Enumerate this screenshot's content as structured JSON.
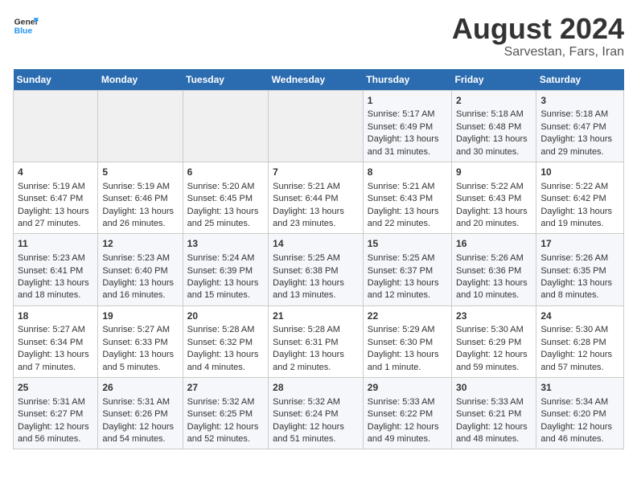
{
  "header": {
    "logo_general": "General",
    "logo_blue": "Blue",
    "title": "August 2024",
    "subtitle": "Sarvestan, Fars, Iran"
  },
  "calendar": {
    "days_of_week": [
      "Sunday",
      "Monday",
      "Tuesday",
      "Wednesday",
      "Thursday",
      "Friday",
      "Saturday"
    ],
    "weeks": [
      [
        {
          "day": "",
          "content": ""
        },
        {
          "day": "",
          "content": ""
        },
        {
          "day": "",
          "content": ""
        },
        {
          "day": "",
          "content": ""
        },
        {
          "day": "1",
          "content": "Sunrise: 5:17 AM\nSunset: 6:49 PM\nDaylight: 13 hours and 31 minutes."
        },
        {
          "day": "2",
          "content": "Sunrise: 5:18 AM\nSunset: 6:48 PM\nDaylight: 13 hours and 30 minutes."
        },
        {
          "day": "3",
          "content": "Sunrise: 5:18 AM\nSunset: 6:47 PM\nDaylight: 13 hours and 29 minutes."
        }
      ],
      [
        {
          "day": "4",
          "content": "Sunrise: 5:19 AM\nSunset: 6:47 PM\nDaylight: 13 hours and 27 minutes."
        },
        {
          "day": "5",
          "content": "Sunrise: 5:19 AM\nSunset: 6:46 PM\nDaylight: 13 hours and 26 minutes."
        },
        {
          "day": "6",
          "content": "Sunrise: 5:20 AM\nSunset: 6:45 PM\nDaylight: 13 hours and 25 minutes."
        },
        {
          "day": "7",
          "content": "Sunrise: 5:21 AM\nSunset: 6:44 PM\nDaylight: 13 hours and 23 minutes."
        },
        {
          "day": "8",
          "content": "Sunrise: 5:21 AM\nSunset: 6:43 PM\nDaylight: 13 hours and 22 minutes."
        },
        {
          "day": "9",
          "content": "Sunrise: 5:22 AM\nSunset: 6:43 PM\nDaylight: 13 hours and 20 minutes."
        },
        {
          "day": "10",
          "content": "Sunrise: 5:22 AM\nSunset: 6:42 PM\nDaylight: 13 hours and 19 minutes."
        }
      ],
      [
        {
          "day": "11",
          "content": "Sunrise: 5:23 AM\nSunset: 6:41 PM\nDaylight: 13 hours and 18 minutes."
        },
        {
          "day": "12",
          "content": "Sunrise: 5:23 AM\nSunset: 6:40 PM\nDaylight: 13 hours and 16 minutes."
        },
        {
          "day": "13",
          "content": "Sunrise: 5:24 AM\nSunset: 6:39 PM\nDaylight: 13 hours and 15 minutes."
        },
        {
          "day": "14",
          "content": "Sunrise: 5:25 AM\nSunset: 6:38 PM\nDaylight: 13 hours and 13 minutes."
        },
        {
          "day": "15",
          "content": "Sunrise: 5:25 AM\nSunset: 6:37 PM\nDaylight: 13 hours and 12 minutes."
        },
        {
          "day": "16",
          "content": "Sunrise: 5:26 AM\nSunset: 6:36 PM\nDaylight: 13 hours and 10 minutes."
        },
        {
          "day": "17",
          "content": "Sunrise: 5:26 AM\nSunset: 6:35 PM\nDaylight: 13 hours and 8 minutes."
        }
      ],
      [
        {
          "day": "18",
          "content": "Sunrise: 5:27 AM\nSunset: 6:34 PM\nDaylight: 13 hours and 7 minutes."
        },
        {
          "day": "19",
          "content": "Sunrise: 5:27 AM\nSunset: 6:33 PM\nDaylight: 13 hours and 5 minutes."
        },
        {
          "day": "20",
          "content": "Sunrise: 5:28 AM\nSunset: 6:32 PM\nDaylight: 13 hours and 4 minutes."
        },
        {
          "day": "21",
          "content": "Sunrise: 5:28 AM\nSunset: 6:31 PM\nDaylight: 13 hours and 2 minutes."
        },
        {
          "day": "22",
          "content": "Sunrise: 5:29 AM\nSunset: 6:30 PM\nDaylight: 13 hours and 1 minute."
        },
        {
          "day": "23",
          "content": "Sunrise: 5:30 AM\nSunset: 6:29 PM\nDaylight: 12 hours and 59 minutes."
        },
        {
          "day": "24",
          "content": "Sunrise: 5:30 AM\nSunset: 6:28 PM\nDaylight: 12 hours and 57 minutes."
        }
      ],
      [
        {
          "day": "25",
          "content": "Sunrise: 5:31 AM\nSunset: 6:27 PM\nDaylight: 12 hours and 56 minutes."
        },
        {
          "day": "26",
          "content": "Sunrise: 5:31 AM\nSunset: 6:26 PM\nDaylight: 12 hours and 54 minutes."
        },
        {
          "day": "27",
          "content": "Sunrise: 5:32 AM\nSunset: 6:25 PM\nDaylight: 12 hours and 52 minutes."
        },
        {
          "day": "28",
          "content": "Sunrise: 5:32 AM\nSunset: 6:24 PM\nDaylight: 12 hours and 51 minutes."
        },
        {
          "day": "29",
          "content": "Sunrise: 5:33 AM\nSunset: 6:22 PM\nDaylight: 12 hours and 49 minutes."
        },
        {
          "day": "30",
          "content": "Sunrise: 5:33 AM\nSunset: 6:21 PM\nDaylight: 12 hours and 48 minutes."
        },
        {
          "day": "31",
          "content": "Sunrise: 5:34 AM\nSunset: 6:20 PM\nDaylight: 12 hours and 46 minutes."
        }
      ]
    ]
  }
}
